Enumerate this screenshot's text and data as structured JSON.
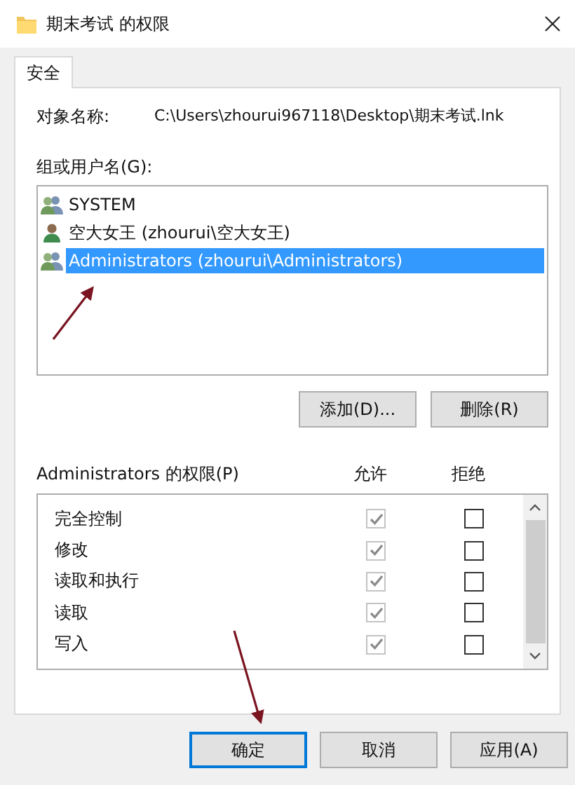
{
  "window": {
    "title": "期末考试 的权限"
  },
  "tabs": [
    {
      "label": "安全",
      "selected": true
    }
  ],
  "object_name": {
    "label": "对象名称:",
    "value": "C:\\Users\\zhourui967118\\Desktop\\期末考试.lnk"
  },
  "users": {
    "label": "组或用户名(G):",
    "items": [
      {
        "name": "SYSTEM",
        "kind": "group",
        "selected": false
      },
      {
        "name": "空大女王 (zhourui\\空大女王)",
        "kind": "user",
        "selected": false
      },
      {
        "name": "Administrators (zhourui\\Administrators)",
        "kind": "group",
        "selected": true
      }
    ]
  },
  "user_buttons": [
    "添加(D)...",
    "删除(R)"
  ],
  "permissions": {
    "label": "Administrators 的权限(P)",
    "columns": [
      "允许",
      "拒绝"
    ],
    "rows": [
      {
        "name": "完全控制",
        "allow_checked": true,
        "allow_disabled": true,
        "deny_checked": false
      },
      {
        "name": "修改",
        "allow_checked": true,
        "allow_disabled": true,
        "deny_checked": false
      },
      {
        "name": "读取和执行",
        "allow_checked": true,
        "allow_disabled": true,
        "deny_checked": false
      },
      {
        "name": "读取",
        "allow_checked": true,
        "allow_disabled": true,
        "deny_checked": false
      },
      {
        "name": "写入",
        "allow_checked": true,
        "allow_disabled": true,
        "deny_checked": false
      }
    ]
  },
  "buttons": [
    {
      "label": "确定",
      "default": true
    },
    {
      "label": "取消",
      "default": false
    },
    {
      "label": "应用(A)",
      "default": false
    }
  ]
}
